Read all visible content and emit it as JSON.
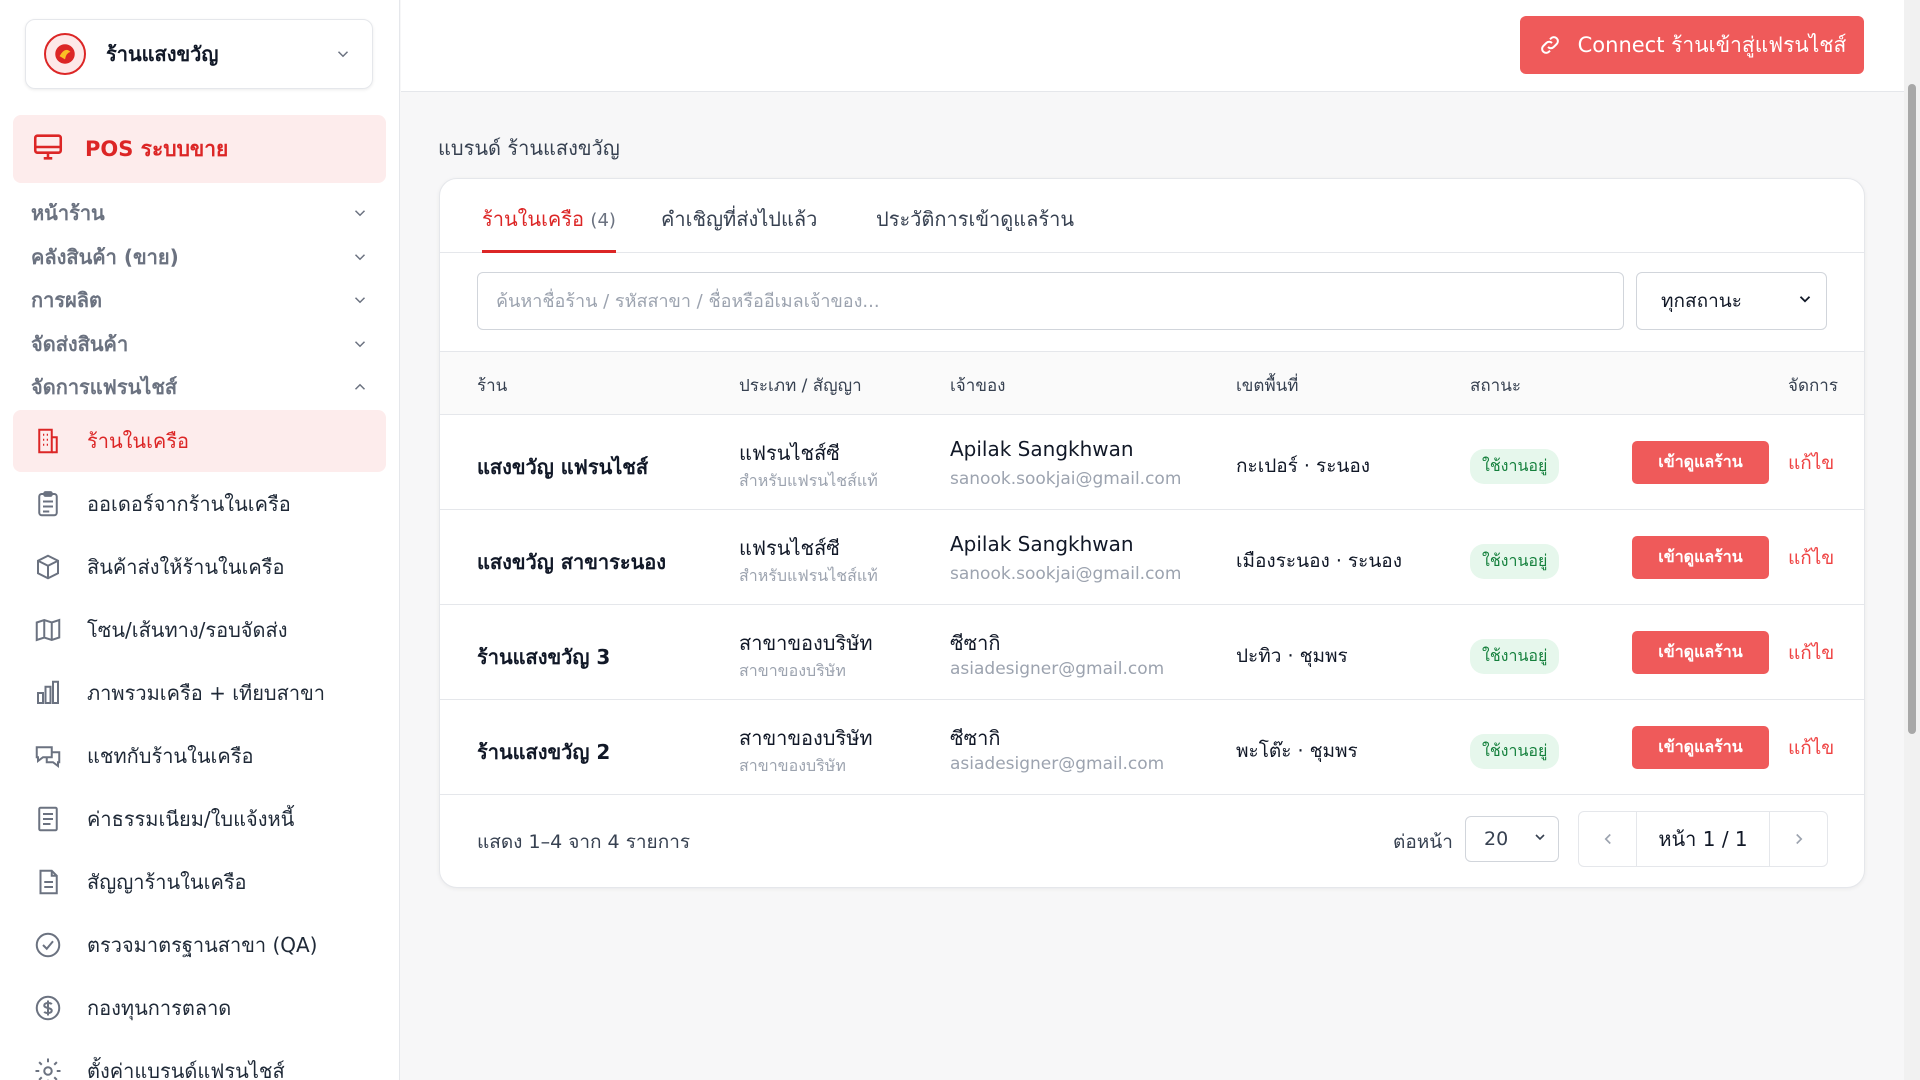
{
  "store": {
    "name": "ร้านแสงขวัญ"
  },
  "pos": {
    "label": "POS ระบบขาย"
  },
  "sections": [
    {
      "label": "หน้าร้าน"
    },
    {
      "label": "คลังสินค้า (ขาย)"
    },
    {
      "label": "การผลิต"
    },
    {
      "label": "จัดส่งสินค้า"
    },
    {
      "label": "จัดการแฟรนไชส์"
    }
  ],
  "nav": [
    {
      "label": "ร้านในเครือ",
      "icon": "building-icon"
    },
    {
      "label": "ออเดอร์จากร้านในเครือ",
      "icon": "clipboard-icon"
    },
    {
      "label": "สินค้าส่งให้ร้านในเครือ",
      "icon": "box-icon"
    },
    {
      "label": "โซน/เส้นทาง/รอบจัดส่ง",
      "icon": "map-icon"
    },
    {
      "label": "ภาพรวมเครือ + เทียบสาขา",
      "icon": "bar-chart-icon"
    },
    {
      "label": "แชทกับร้านในเครือ",
      "icon": "chat-icon"
    },
    {
      "label": "ค่าธรรมเนียม/ใบแจ้งหนี้",
      "icon": "receipt-icon"
    },
    {
      "label": "สัญญาร้านในเครือ",
      "icon": "document-icon"
    },
    {
      "label": "ตรวจมาตรฐานสาขา (QA)",
      "icon": "check-circle-icon"
    },
    {
      "label": "กองทุนการตลาด",
      "icon": "dollar-icon"
    },
    {
      "label": "ตั้งค่าแบรนด์แฟรนไชส์",
      "icon": "gear-icon"
    }
  ],
  "topbar": {
    "connect_label": "Connect ร้านเข้าสู่แฟรนไชส์"
  },
  "brand_line": "แบรนด์ ร้านแสงขวัญ",
  "tabs": [
    {
      "label": "ร้านในเครือ",
      "count": "(4)"
    },
    {
      "label": "คำเชิญที่ส่งไปแล้ว"
    },
    {
      "label": "ประวัติการเข้าดูแลร้าน"
    }
  ],
  "search": {
    "placeholder": "ค้นหาชื่อร้าน / รหัสสาขา / ชื่อหรืออีเมลเจ้าของ..."
  },
  "status_filter": {
    "value": "ทุกสถานะ"
  },
  "columns": [
    "ร้าน",
    "ประเภท / สัญญา",
    "เจ้าของ",
    "เขตพื้นที่",
    "สถานะ",
    "จัดการ"
  ],
  "rows": [
    {
      "shop": "แสงขวัญ แฟรนไชส์",
      "type": "แฟรนไชส์ซี",
      "contract": "สำหรับแฟรนไชส์แท้",
      "owner": "Apilak Sangkhwan",
      "email": "sanook.sookjai@gmail.com",
      "area": "กะเปอร์ · ระนอง",
      "status": "ใช้งานอยู่",
      "view": "เข้าดูแลร้าน",
      "edit": "แก้ไข"
    },
    {
      "shop": "แสงขวัญ สาขาระนอง",
      "type": "แฟรนไชส์ซี",
      "contract": "สำหรับแฟรนไชส์แท้",
      "owner": "Apilak Sangkhwan",
      "email": "sanook.sookjai@gmail.com",
      "area": "เมืองระนอง · ระนอง",
      "status": "ใช้งานอยู่",
      "view": "เข้าดูแลร้าน",
      "edit": "แก้ไข"
    },
    {
      "shop": "ร้านแสงขวัญ 3",
      "type": "สาขาของบริษัท",
      "contract": "สาขาของบริษัท",
      "owner": "ซีซากิ",
      "email": "asiadesigner@gmail.com",
      "area": "ปะทิว · ชุมพร",
      "status": "ใช้งานอยู่",
      "view": "เข้าดูแลร้าน",
      "edit": "แก้ไข"
    },
    {
      "shop": "ร้านแสงขวัญ 2",
      "type": "สาขาของบริษัท",
      "contract": "สาขาของบริษัท",
      "owner": "ซีซากิ",
      "email": "asiadesigner@gmail.com",
      "area": "พะโต๊ะ · ชุมพร",
      "status": "ใช้งานอยู่",
      "view": "เข้าดูแลร้าน",
      "edit": "แก้ไข"
    }
  ],
  "footer": {
    "info": "แสดง 1–4 จาก 4 รายการ",
    "per_page_label": "ต่อหน้า",
    "per_page_value": "20",
    "page_label": "หน้า 1 / 1"
  },
  "colors": {
    "accent": "#ef5a5a",
    "accent_text": "#dc2626",
    "active_bg": "#fdecec",
    "badge_bg": "#e6f7ec",
    "badge_text": "#15803d"
  }
}
